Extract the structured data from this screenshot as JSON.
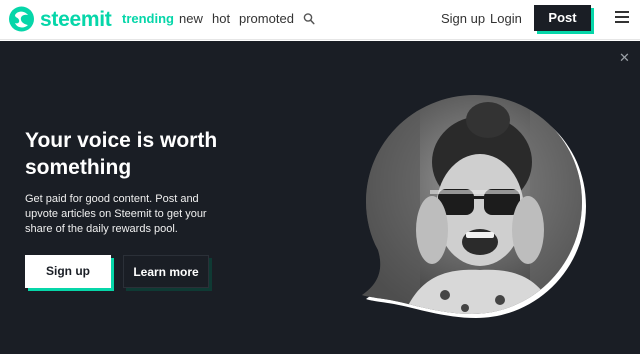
{
  "header": {
    "brand": "steemit",
    "nav": [
      "trending",
      "new",
      "hot",
      "promoted"
    ],
    "active_nav": "trending",
    "signup_label": "Sign up",
    "login_label": "Login",
    "post_label": "Post"
  },
  "hero": {
    "title": "Your voice is worth something",
    "description": "Get paid for good content. Post and upvote articles on Steemit to get your share of the daily rewards pool.",
    "signup_label": "Sign up",
    "learn_more_label": "Learn more"
  },
  "colors": {
    "brand": "#06d6a9",
    "dark": "#1a1e25"
  },
  "icons": [
    "steemit-logo-icon",
    "search-icon",
    "menu-icon",
    "close-icon"
  ]
}
